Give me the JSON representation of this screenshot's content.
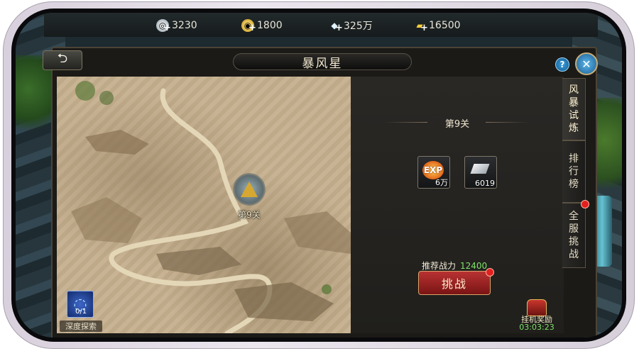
{
  "resources": [
    {
      "icon": "silver-coin-icon",
      "value": "3230"
    },
    {
      "icon": "gold-coin-icon",
      "value": "1800"
    },
    {
      "icon": "crystal-icon",
      "value": "325万"
    },
    {
      "icon": "gold-bar-icon",
      "value": "16500"
    }
  ],
  "header": {
    "title": "暴风星"
  },
  "map": {
    "node_label": "第9关",
    "deep_explore": {
      "label": "深度探索",
      "count": "0/1"
    }
  },
  "info": {
    "stage_title": "第9关",
    "rewards": [
      {
        "icon": "exp-icon",
        "icon_text": "EXP",
        "count": "6万"
      },
      {
        "icon": "silver-bar-icon",
        "count": "6019"
      }
    ],
    "power_label": "推荐战力",
    "power_value": "12400",
    "challenge_label": "挑战",
    "idle": {
      "label": "挂机奖励",
      "timer": "03:03:23"
    }
  },
  "tabs": [
    {
      "label": "风暴试炼",
      "active": true
    },
    {
      "label": "排行榜",
      "active": false
    },
    {
      "label": "全服挑战",
      "active": false
    }
  ],
  "colors": {
    "accent_green": "#7fe36a",
    "challenge_red": "#b83232",
    "notify_red": "#e21f1f"
  }
}
